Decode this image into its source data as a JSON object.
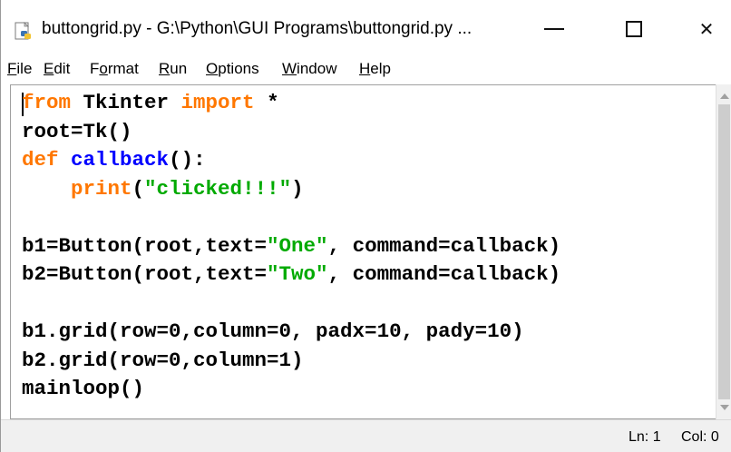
{
  "window": {
    "title": "buttongrid.py - G:\\Python\\GUI Programs\\buttongrid.py ...",
    "app_icon": "python-idle-icon"
  },
  "controls": {
    "minimize_icon": "minimize-icon",
    "maximize_icon": "maximize-icon",
    "close_icon": "close-icon",
    "close_glyph": "✕"
  },
  "menu": {
    "items": [
      {
        "label_u": "F",
        "label_rest": "ile"
      },
      {
        "label_u": "E",
        "label_rest": "dit"
      },
      {
        "label_pre": "F",
        "label_u": "o",
        "label_rest": "rmat"
      },
      {
        "label_u": "R",
        "label_rest": "un"
      },
      {
        "label_u": "O",
        "label_rest": "ptions"
      },
      {
        "label_u": "W",
        "label_rest": "indow"
      },
      {
        "label_u": "H",
        "label_rest": "elp"
      }
    ]
  },
  "code": {
    "l1_kw1": "from",
    "l1_mid": " Tkinter ",
    "l1_kw2": "import",
    "l1_end": " *",
    "l2": "root=Tk()",
    "l3_kw": "def",
    "l3_sp": " ",
    "l3_fn": "callback",
    "l3_end": "():",
    "l4_indent": "    ",
    "l4_kw": "print",
    "l4_open": "(",
    "l4_str": "\"clicked!!!\"",
    "l4_close": ")",
    "l6_a": "b1=Button(root,text=",
    "l6_str": "\"One\"",
    "l6_b": ", command=callback)",
    "l7_a": "b2=Button(root,text=",
    "l7_str": "\"Two\"",
    "l7_b": ", command=callback)",
    "l9": "b1.grid(row=0,column=0, padx=10, pady=10)",
    "l10": "b2.grid(row=0,column=1)",
    "l11": "mainloop()"
  },
  "status": {
    "line": "Ln: 1",
    "col": "Col: 0"
  },
  "colors": {
    "keyword": "#ff7700",
    "function_name": "#0000ff",
    "string": "#00aa00"
  }
}
